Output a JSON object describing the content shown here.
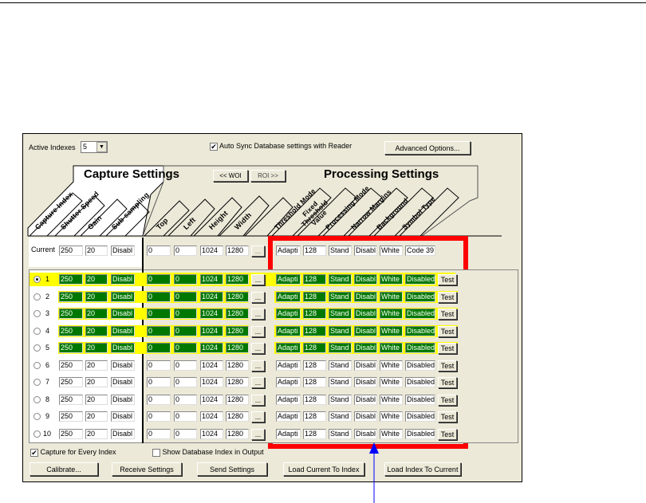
{
  "active_indexes": {
    "label": "Active Indexes",
    "value": "5"
  },
  "auto_sync": {
    "label": "Auto Sync Database settings with Reader",
    "checked": true
  },
  "advanced_options": "Advanced Options...",
  "capture_settings_title": "Capture Settings",
  "processing_settings_title": "Processing Settings",
  "woi_button": "<< WOI",
  "roi_button": "ROI >>",
  "capture_headers": [
    "Capture Index",
    "Shutter Speed",
    "Gain",
    "Sub-sampling"
  ],
  "woi_headers": [
    "Top",
    "Left",
    "Height",
    "Width"
  ],
  "processing_headers": [
    "Threshold Mode",
    "Fixed Threshold Value",
    "Processing Mode",
    "Narrow Margins",
    "Background",
    "Symbol Type"
  ],
  "current": {
    "label": "Current",
    "shutter": "250",
    "gain": "20",
    "subsampling": "Disabl",
    "top": "0",
    "left": "0",
    "height": "1024",
    "width": "1280",
    "dots": "...",
    "threshold_mode": "Adapti",
    "fixed_threshold": "128",
    "processing_mode": "Stand",
    "narrow_margins": "Disabl",
    "background": "White",
    "symbol_type": "Code 39"
  },
  "rows": [
    {
      "index": "1",
      "selected": true,
      "active": true,
      "values": [
        "250",
        "20",
        "Disabl",
        "0",
        "0",
        "1024",
        "1280",
        "Adapti",
        "128",
        "Stand",
        "Disabl",
        "White",
        "Disabled"
      ]
    },
    {
      "index": "2",
      "selected": false,
      "active": true,
      "values": [
        "250",
        "20",
        "Disabl",
        "0",
        "0",
        "1024",
        "1280",
        "Adapti",
        "128",
        "Stand",
        "Disabl",
        "White",
        "Disabled"
      ]
    },
    {
      "index": "3",
      "selected": false,
      "active": true,
      "values": [
        "250",
        "20",
        "Disabl",
        "0",
        "0",
        "1024",
        "1280",
        "Adapti",
        "128",
        "Stand",
        "Disabl",
        "White",
        "Disabled"
      ]
    },
    {
      "index": "4",
      "selected": false,
      "active": true,
      "values": [
        "250",
        "20",
        "Disabl",
        "0",
        "0",
        "1024",
        "1280",
        "Adapti",
        "128",
        "Stand",
        "Disabl",
        "White",
        "Disabled"
      ]
    },
    {
      "index": "5",
      "selected": false,
      "active": true,
      "values": [
        "250",
        "20",
        "Disabl",
        "0",
        "0",
        "1024",
        "1280",
        "Adapti",
        "128",
        "Stand",
        "Disabl",
        "White",
        "Disabled"
      ]
    },
    {
      "index": "6",
      "selected": false,
      "active": false,
      "values": [
        "250",
        "20",
        "Disabl",
        "0",
        "0",
        "1024",
        "1280",
        "Adapti",
        "128",
        "Stand",
        "Disabl",
        "White",
        "Disabled"
      ]
    },
    {
      "index": "7",
      "selected": false,
      "active": false,
      "values": [
        "250",
        "20",
        "Disabl",
        "0",
        "0",
        "1024",
        "1280",
        "Adapti",
        "128",
        "Stand",
        "Disabl",
        "White",
        "Disabled"
      ]
    },
    {
      "index": "8",
      "selected": false,
      "active": false,
      "values": [
        "250",
        "20",
        "Disabl",
        "0",
        "0",
        "1024",
        "1280",
        "Adapti",
        "128",
        "Stand",
        "Disabl",
        "White",
        "Disabled"
      ]
    },
    {
      "index": "9",
      "selected": false,
      "active": false,
      "values": [
        "250",
        "20",
        "Disabl",
        "0",
        "0",
        "1024",
        "1280",
        "Adapti",
        "128",
        "Stand",
        "Disabl",
        "White",
        "Disabled"
      ]
    },
    {
      "index": "10",
      "selected": false,
      "active": false,
      "values": [
        "250",
        "20",
        "Disabl",
        "0",
        "0",
        "1024",
        "1280",
        "Adapti",
        "128",
        "Stand",
        "Disabl",
        "White",
        "Disabled"
      ]
    }
  ],
  "row_dots": "...",
  "test_label": "Test",
  "capture_every_index": {
    "label": "Capture for Every Index",
    "checked": true
  },
  "show_db_index": {
    "label": "Show Database Index in Output",
    "checked": false
  },
  "buttons": {
    "calibrate": "Calibrate...",
    "receive": "Receive Settings",
    "send": "Send Settings",
    "load_current_to_index": "Load Current To Index",
    "load_index_to_current": "Load Index To Current"
  },
  "colors": {
    "highlight_box": "#ff0000",
    "active_field": "#007800",
    "selected_row": "#ffff00",
    "arrow": "#0000ff"
  }
}
